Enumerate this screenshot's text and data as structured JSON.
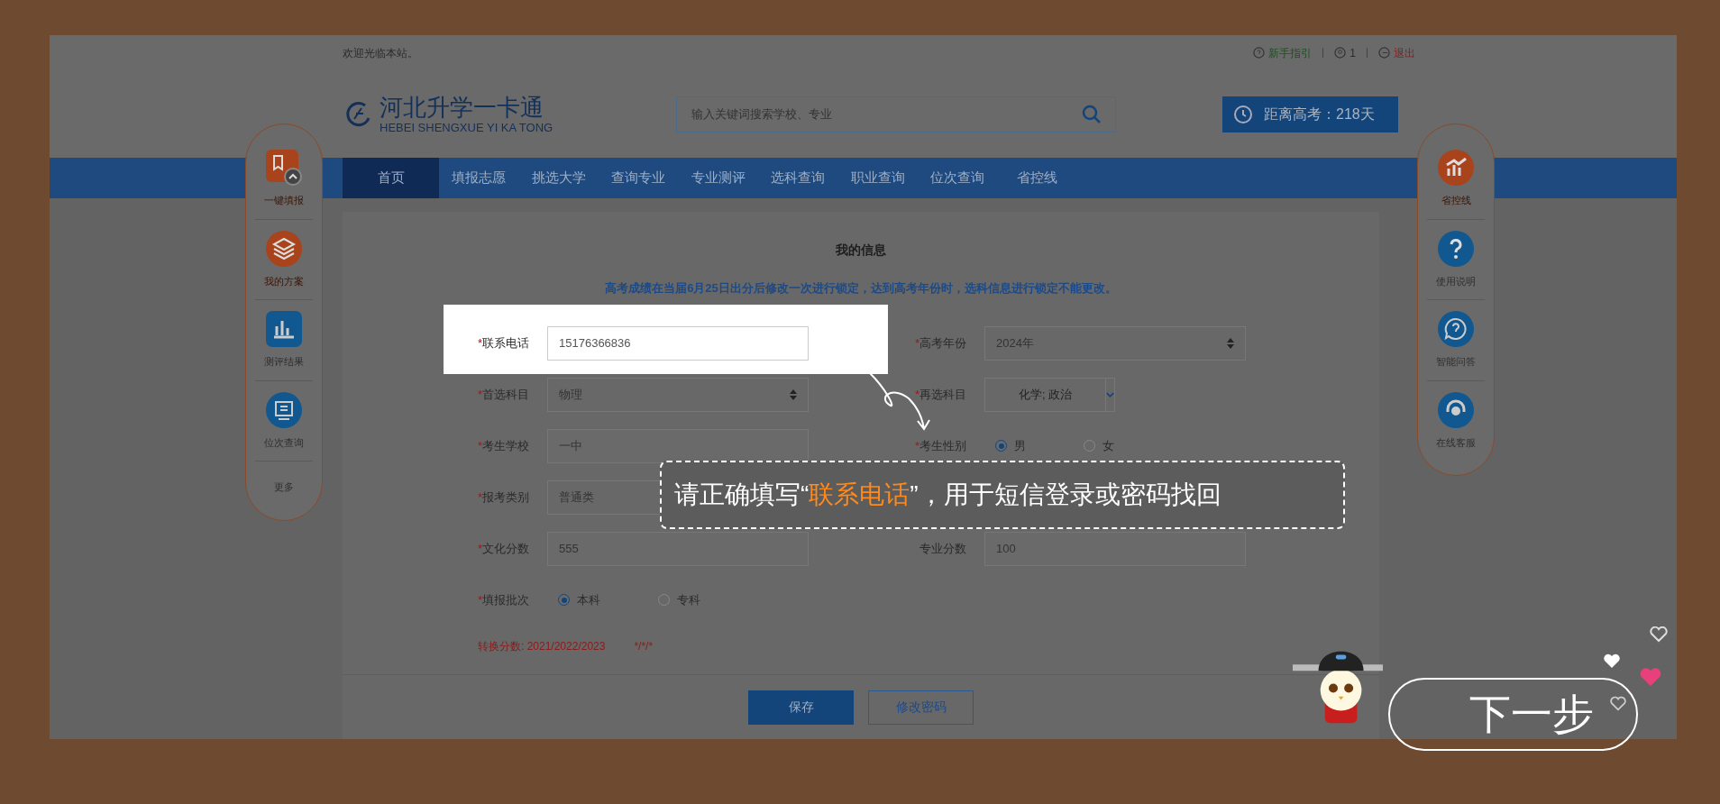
{
  "top_bar": {
    "welcome": "欢迎光临本站。",
    "links": [
      {
        "kind": "guide",
        "label": "新手指引"
      },
      {
        "kind": "user",
        "label": "1"
      },
      {
        "kind": "logout",
        "label": "退出"
      }
    ]
  },
  "header": {
    "logo_title": "河北升学一卡通",
    "logo_subtitle": "HEBEI SHENGXUE YI KA TONG",
    "search": {
      "placeholder": "输入关键词搜索学校、专业"
    },
    "countdown": "距离高考：218天"
  },
  "nav": [
    {
      "label": "首页",
      "selected": true
    },
    {
      "label": "填报志愿",
      "selected": false
    },
    {
      "label": "挑选大学",
      "selected": false
    },
    {
      "label": "查询专业",
      "selected": false
    },
    {
      "label": "专业测评",
      "selected": false
    },
    {
      "label": "选科查询",
      "selected": false
    },
    {
      "label": "职业查询",
      "selected": false
    },
    {
      "label": "位次查询",
      "selected": false
    },
    {
      "label": "省控线",
      "selected": false
    }
  ],
  "left_sidebar": [
    {
      "kind": "bookmark",
      "label": "一键填报",
      "highlighted": true
    },
    {
      "kind": "layers",
      "label": "我的方案",
      "highlighted": true
    },
    {
      "kind": "bars",
      "label": "测评结果",
      "highlighted": false
    },
    {
      "kind": "monitor",
      "label": "位次查询",
      "highlighted": false
    },
    {
      "kind": "more",
      "label": "更多",
      "highlighted": false
    }
  ],
  "right_sidebar": [
    {
      "kind": "chart",
      "label": "省控线",
      "highlighted": true
    },
    {
      "kind": "help",
      "label": "使用说明",
      "highlighted": false
    },
    {
      "kind": "chat",
      "label": "智能问答",
      "highlighted": false
    },
    {
      "kind": "service",
      "label": "在线客服",
      "highlighted": false
    }
  ],
  "form": {
    "title": "我的信息",
    "notice": "高考成绩在当届6月25日出分后修改一次进行锁定，达到高考年份时，选科信息进行锁定不能更改。",
    "rows": [
      [
        {
          "kind": "text",
          "mark": "*",
          "label": "联系电话",
          "value": "15176366836",
          "highlighted": true
        },
        {
          "kind": "select",
          "mark": "*",
          "label": "高考年份",
          "value": "2024年"
        }
      ],
      [
        {
          "kind": "select",
          "mark": "*",
          "label": "首选科目",
          "value": "物理"
        },
        {
          "kind": "multiselect",
          "mark": "*",
          "label": "再选科目",
          "value": "化学; 政治"
        }
      ],
      [
        {
          "kind": "text",
          "mark": "*",
          "label": "考生学校",
          "value": "一中"
        },
        {
          "kind": "radio",
          "mark": "*",
          "label": "考生性别",
          "options": [
            {
              "label": "男",
              "selected": true
            },
            {
              "label": "女",
              "selected": false
            }
          ]
        }
      ],
      [
        {
          "kind": "select",
          "mark": "*",
          "label": "报考类别",
          "value": "普通类"
        }
      ],
      [
        {
          "kind": "text",
          "mark": "*",
          "label": "文化分数",
          "value": "555"
        },
        {
          "kind": "text",
          "label": "专业分数",
          "value": "100"
        }
      ],
      [
        {
          "kind": "radio",
          "mark": "*",
          "label": "填报批次",
          "options": [
            {
              "label": "本科",
              "selected": true
            },
            {
              "label": "专科",
              "selected": false
            }
          ]
        }
      ]
    ],
    "conversion": {
      "label": "转换分数: 2021/2022/2023",
      "value": "*/*/*"
    },
    "buttons": [
      {
        "kind": "primary",
        "label": "保存"
      },
      {
        "kind": "outline",
        "label": "修改密码"
      }
    ]
  },
  "tooltip": {
    "prefix": "请正确填写“",
    "highlight": "联系电话",
    "suffix": "”，用于短信登录或密码找回"
  },
  "next_button": "下一步"
}
